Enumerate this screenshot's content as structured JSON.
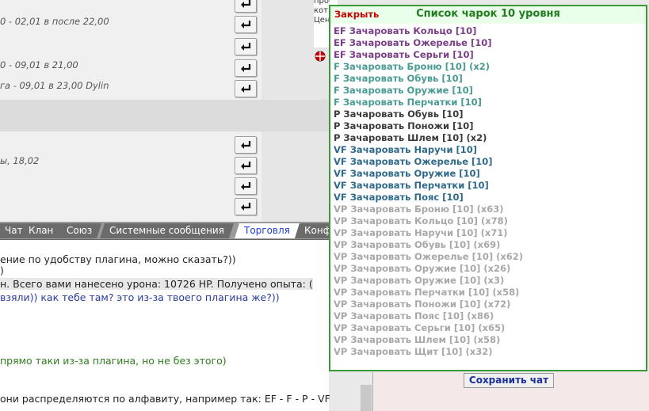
{
  "background": {
    "messages": [
      "0 - 02,01 в после 22,00",
      "0 - 09,01 в 21,00",
      "га - 09,01 в 23,00 Dylin",
      "ы, 18,02"
    ],
    "top_text_fragments": [
      "просьба обращаться к тем паладинам или тарманам, чики",
      "кот",
      "Цен"
    ]
  },
  "tabs": [
    {
      "label": "Чат",
      "active": false
    },
    {
      "label": "Клан",
      "active": false
    },
    {
      "label": "Союз",
      "active": false
    },
    {
      "label": "Системные сообщения",
      "active": false
    },
    {
      "label": "Торговля",
      "active": true
    },
    {
      "label": "Конф",
      "active": false
    }
  ],
  "chat": {
    "lines": [
      {
        "text": "ение по удобству плагина, можно сказать?))",
        "style": ""
      },
      {
        "text": ")",
        "style": ""
      },
      {
        "text": "н. Всего вами нанесено урона: 10726 HP. Получено опыта: (",
        "style": "hl"
      },
      {
        "text": "взяли)) как тебе там? это из-за твоего плагина же?))",
        "style": "blue"
      },
      {
        "text": "прямо таки из-за плагина, но не без этого)",
        "style": "green"
      },
      {
        "text": "они распределяются по алфавиту, например так: EF - F - P - VF",
        "style": ""
      }
    ]
  },
  "save_chat_label": "Сохранить чат",
  "popup": {
    "close_label": "Закрыть",
    "title": "Список чарок 10 уровня",
    "items": [
      {
        "text": "EF Зачаровать Кольцо [10]",
        "color": "#7a3e86"
      },
      {
        "text": "EF Зачаровать Ожерелье [10]",
        "color": "#7a3e86"
      },
      {
        "text": "EF Зачаровать Серьги [10]",
        "color": "#7a3e86"
      },
      {
        "text": "F Зачаровать Броню [10] (x2)",
        "color": "#4a9a94"
      },
      {
        "text": "F Зачаровать Обувь [10]",
        "color": "#4a9a94"
      },
      {
        "text": "F Зачаровать Оружие [10]",
        "color": "#4a9a94"
      },
      {
        "text": "F Зачаровать Перчатки [10]",
        "color": "#4a9a94"
      },
      {
        "text": "P Зачаровать Обувь [10]",
        "color": "#3a3a3a"
      },
      {
        "text": "P Зачаровать Поножи [10]",
        "color": "#3a3a3a"
      },
      {
        "text": "P Зачаровать Шлем [10] (x2)",
        "color": "#3a3a3a"
      },
      {
        "text": "VF Зачаровать Наручи [10]",
        "color": "#2f6a8a"
      },
      {
        "text": "VF Зачаровать Ожерелье [10]",
        "color": "#2f6a8a"
      },
      {
        "text": "VF Зачаровать Оружие [10]",
        "color": "#2f6a8a"
      },
      {
        "text": "VF Зачаровать Перчатки [10]",
        "color": "#2f6a8a"
      },
      {
        "text": "VF Зачаровать Пояс [10]",
        "color": "#2f6a8a"
      },
      {
        "text": "VP Зачаровать Броню [10] (x63)",
        "color": "#a8a8a8"
      },
      {
        "text": "VP Зачаровать Кольцо [10] (x78)",
        "color": "#a8a8a8"
      },
      {
        "text": "VP Зачаровать Наручи [10] (x71)",
        "color": "#a8a8a8"
      },
      {
        "text": "VP Зачаровать Обувь [10] (x69)",
        "color": "#a8a8a8"
      },
      {
        "text": "VP Зачаровать Ожерелье [10] (x62)",
        "color": "#a8a8a8"
      },
      {
        "text": "VP Зачаровать Оружие [10] (x26)",
        "color": "#a8a8a8"
      },
      {
        "text": "VP Зачаровать Оружие [10] (x3)",
        "color": "#a8a8a8"
      },
      {
        "text": "VP Зачаровать Перчатки [10] (x58)",
        "color": "#a8a8a8"
      },
      {
        "text": "VP Зачаровать Поножи [10] (x72)",
        "color": "#a8a8a8"
      },
      {
        "text": "VP Зачаровать Пояс [10] (x86)",
        "color": "#a8a8a8"
      },
      {
        "text": "VP Зачаровать Серьги [10] (x65)",
        "color": "#a8a8a8"
      },
      {
        "text": "VP Зачаровать Шлем [10] (x58)",
        "color": "#a8a8a8"
      },
      {
        "text": "VP Зачаровать Щит [10] (x32)",
        "color": "#a8a8a8"
      }
    ]
  }
}
